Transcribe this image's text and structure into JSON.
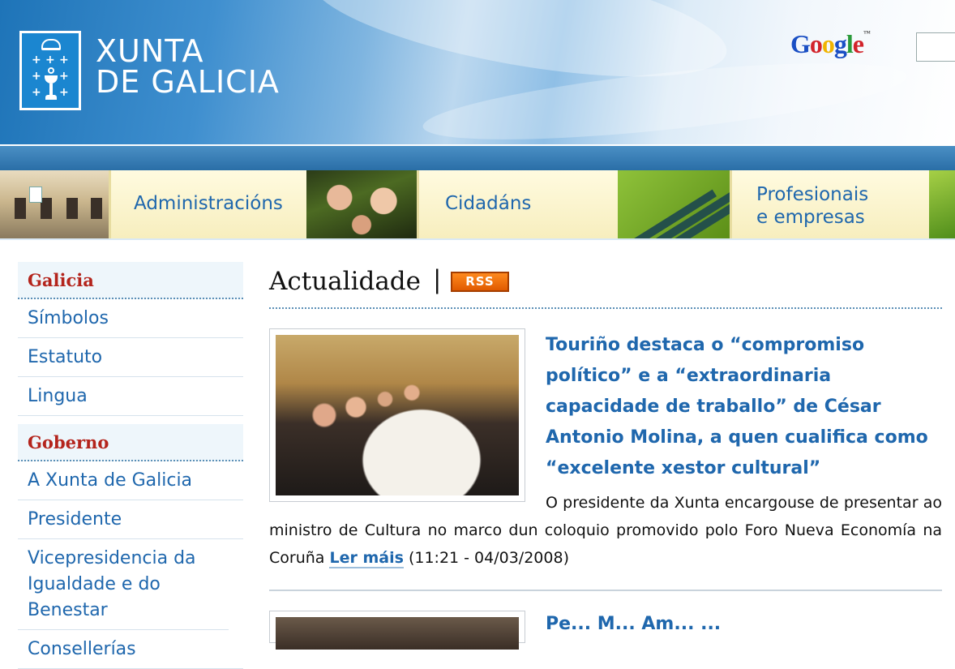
{
  "header": {
    "brand_line1": "XUNTA",
    "brand_line2": "DE GALICIA",
    "search_provider": "Google",
    "search_value": ""
  },
  "nav": {
    "items": [
      {
        "label": "Administracións"
      },
      {
        "label": "Cidadáns"
      },
      {
        "label_line1": "Profesionais",
        "label_line2": "e empresas"
      }
    ]
  },
  "sidebar": {
    "sections": [
      {
        "heading": "Galicia",
        "items": [
          "Símbolos",
          "Estatuto",
          "Lingua"
        ]
      },
      {
        "heading": "Goberno",
        "items": [
          "A Xunta de Galicia",
          "Presidente",
          "Vicepresidencia da Igualdade e do Benestar",
          "Consellerías"
        ]
      }
    ]
  },
  "main": {
    "title": "Actualidade",
    "separator": "|",
    "rss_label": "RSS",
    "news": [
      {
        "title": "Touriño destaca o “compromiso político” e a “extraordinaria capacidade de traballo” de César Antonio Molina, a quen cualifica como “excelente xestor cultural”",
        "body_line1": "O presidente da Xunta encargouse de",
        "body_rest": "presentar ao ministro de Cultura no marco dun coloquio promovido polo Foro Nueva Economía na Coruña",
        "read_more": "Ler máis",
        "timestamp": "(11:21 - 04/03/2008)"
      },
      {
        "title": "Pe... M... Am... ..."
      }
    ]
  },
  "colors": {
    "link_blue": "#1f67ad",
    "heading_red": "#b4241c",
    "rss_orange": "#ff7a00"
  }
}
